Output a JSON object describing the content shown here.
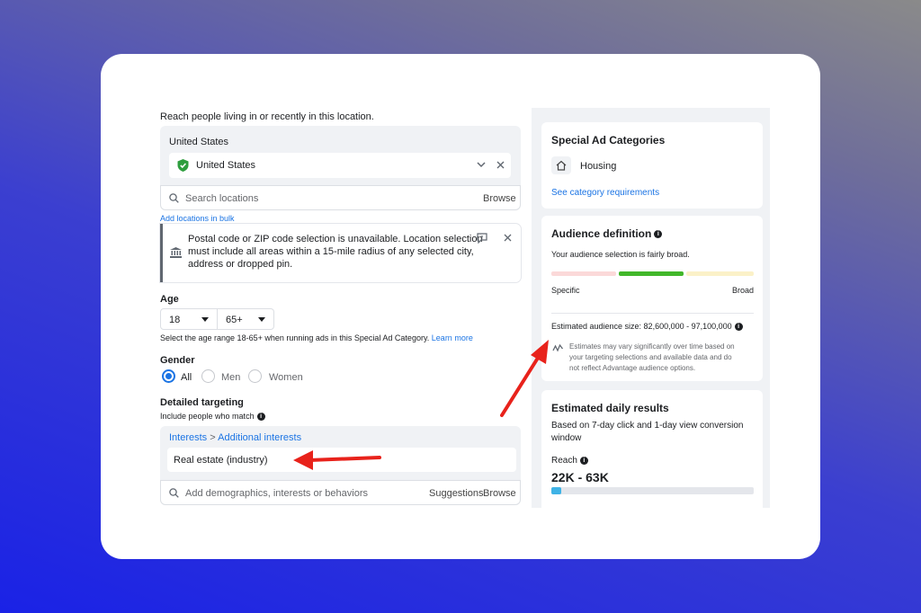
{
  "location": {
    "intro": "Reach people living in or recently in this location.",
    "country_header": "United States",
    "selected": "United States",
    "search_placeholder": "Search locations",
    "browse": "Browse",
    "bulk_link": "Add locations in bulk",
    "notice_line1": "Postal code or ZIP code selection is unavailable. Location selection",
    "notice_line2": "must include all areas within a 15-mile radius of any selected city,",
    "notice_line3": "address or dropped pin."
  },
  "age": {
    "label": "Age",
    "min": "18",
    "max": "65+",
    "note": "Select the age range 18-65+ when running ads in this Special Ad Category.",
    "learn_more": "Learn more"
  },
  "gender": {
    "label": "Gender",
    "options": [
      "All",
      "Men",
      "Women"
    ],
    "selected": "All"
  },
  "detailed": {
    "label": "Detailed targeting",
    "include": "Include people who match",
    "crumb_interests": "Interests",
    "crumb_sep": ">",
    "crumb_additional": "Additional interests",
    "item": "Real estate (industry)",
    "search_placeholder": "Add demographics, interests or behaviors",
    "suggestions": "Suggestions",
    "browse": "Browse"
  },
  "special": {
    "title": "Special Ad Categories",
    "category": "Housing",
    "requirements_link": "See category requirements"
  },
  "audience": {
    "title": "Audience definition",
    "summary": "Your audience selection is fairly broad.",
    "specific": "Specific",
    "broad": "Broad",
    "estimated_label": "Estimated audience size: 82,600,000 - 97,100,000",
    "note_line1": "Estimates may vary significantly over time based on",
    "note_line2": "your targeting selections and available data and do",
    "note_line3": "not reflect Advantage audience options."
  },
  "daily": {
    "title": "Estimated daily results",
    "basis_line1": "Based on 7-day click and 1-day view conversion",
    "basis_line2": "window",
    "reach_label": "Reach",
    "reach_value": "22K - 63K",
    "reach_progress": 0.05
  },
  "colors": {
    "accent": "#1b74e4",
    "meter_green": "#42b72a",
    "arrow_red": "#e8221b"
  }
}
